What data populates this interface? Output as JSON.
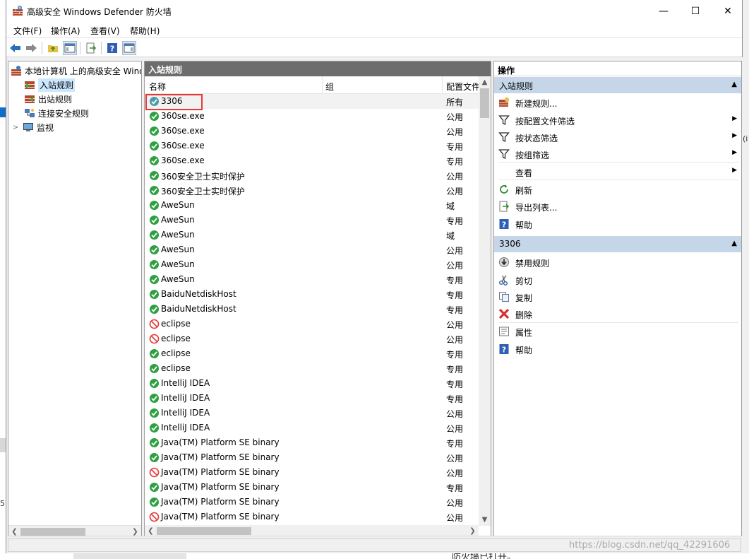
{
  "window": {
    "title": "高级安全 Windows Defender 防火墙",
    "minimize": "—",
    "maximize": "☐",
    "close": "✕"
  },
  "menu": [
    "文件(F)",
    "操作(A)",
    "查看(V)",
    "帮助(H)"
  ],
  "tree": {
    "root": "本地计算机 上的高级安全 Windows Defender 防火墙",
    "items": [
      "入站规则",
      "出站规则",
      "连接安全规则",
      "监视"
    ],
    "expander": ">"
  },
  "middle": {
    "header": "入站规则",
    "columns": [
      "名称",
      "组",
      "配置文件"
    ],
    "rows": [
      {
        "name": "3306",
        "profile": "所有",
        "status": "enabled-selected"
      },
      {
        "name": "360se.exe",
        "profile": "公用",
        "status": "enabled"
      },
      {
        "name": "360se.exe",
        "profile": "公用",
        "status": "enabled"
      },
      {
        "name": "360se.exe",
        "profile": "专用",
        "status": "enabled"
      },
      {
        "name": "360se.exe",
        "profile": "专用",
        "status": "enabled"
      },
      {
        "name": "360安全卫士实时保护",
        "profile": "公用",
        "status": "enabled"
      },
      {
        "name": "360安全卫士实时保护",
        "profile": "公用",
        "status": "enabled"
      },
      {
        "name": "AweSun",
        "profile": "域",
        "status": "enabled"
      },
      {
        "name": "AweSun",
        "profile": "专用",
        "status": "enabled"
      },
      {
        "name": "AweSun",
        "profile": "域",
        "status": "enabled"
      },
      {
        "name": "AweSun",
        "profile": "公用",
        "status": "enabled"
      },
      {
        "name": "AweSun",
        "profile": "公用",
        "status": "enabled"
      },
      {
        "name": "AweSun",
        "profile": "专用",
        "status": "enabled"
      },
      {
        "name": "BaiduNetdiskHost",
        "profile": "专用",
        "status": "enabled"
      },
      {
        "name": "BaiduNetdiskHost",
        "profile": "专用",
        "status": "enabled"
      },
      {
        "name": "eclipse",
        "profile": "公用",
        "status": "blocked"
      },
      {
        "name": "eclipse",
        "profile": "公用",
        "status": "blocked"
      },
      {
        "name": "eclipse",
        "profile": "专用",
        "status": "enabled"
      },
      {
        "name": "eclipse",
        "profile": "专用",
        "status": "enabled"
      },
      {
        "name": "IntelliJ IDEA",
        "profile": "专用",
        "status": "enabled"
      },
      {
        "name": "IntelliJ IDEA",
        "profile": "专用",
        "status": "enabled"
      },
      {
        "name": "IntelliJ IDEA",
        "profile": "公用",
        "status": "enabled"
      },
      {
        "name": "IntelliJ IDEA",
        "profile": "公用",
        "status": "enabled"
      },
      {
        "name": "Java(TM) Platform SE binary",
        "profile": "专用",
        "status": "enabled"
      },
      {
        "name": "Java(TM) Platform SE binary",
        "profile": "公用",
        "status": "enabled"
      },
      {
        "name": "Java(TM) Platform SE binary",
        "profile": "公用",
        "status": "blocked"
      },
      {
        "name": "Java(TM) Platform SE binary",
        "profile": "专用",
        "status": "enabled"
      },
      {
        "name": "Java(TM) Platform SE binary",
        "profile": "公用",
        "status": "enabled"
      },
      {
        "name": "Java(TM) Platform SE binary",
        "profile": "公用",
        "status": "blocked"
      }
    ]
  },
  "actions": {
    "title": "操作",
    "section1": {
      "header": "入站规则",
      "items": [
        {
          "label": "新建规则...",
          "icon": "new-rule-icon"
        },
        {
          "label": "按配置文件筛选",
          "icon": "filter-icon",
          "submenu": true
        },
        {
          "label": "按状态筛选",
          "icon": "filter-icon",
          "submenu": true
        },
        {
          "label": "按组筛选",
          "icon": "filter-icon",
          "submenu": true
        },
        {
          "label": "查看",
          "icon": "",
          "submenu": true
        },
        {
          "label": "刷新",
          "icon": "refresh-icon"
        },
        {
          "label": "导出列表...",
          "icon": "export-icon"
        },
        {
          "label": "帮助",
          "icon": "help-icon"
        }
      ]
    },
    "section2": {
      "header": "3306",
      "items": [
        {
          "label": "禁用规则",
          "icon": "disable-icon"
        },
        {
          "label": "剪切",
          "icon": "cut-icon"
        },
        {
          "label": "复制",
          "icon": "copy-icon"
        },
        {
          "label": "删除",
          "icon": "delete-icon"
        },
        {
          "label": "属性",
          "icon": "properties-icon"
        },
        {
          "label": "帮助",
          "icon": "help-icon"
        }
      ]
    }
  },
  "background": {
    "watermark": "https://blog.csdn.net/qq_42291606",
    "bottom_text": "防火墙已打开。",
    "left_fragment": "5",
    "right_fragment": "(i"
  },
  "colors": {
    "enabled": "#2ea043",
    "blocked": "#e53935",
    "selection": "#cce8ff",
    "section_header": "#c5d6e9",
    "highlight_box": "#e53935"
  }
}
